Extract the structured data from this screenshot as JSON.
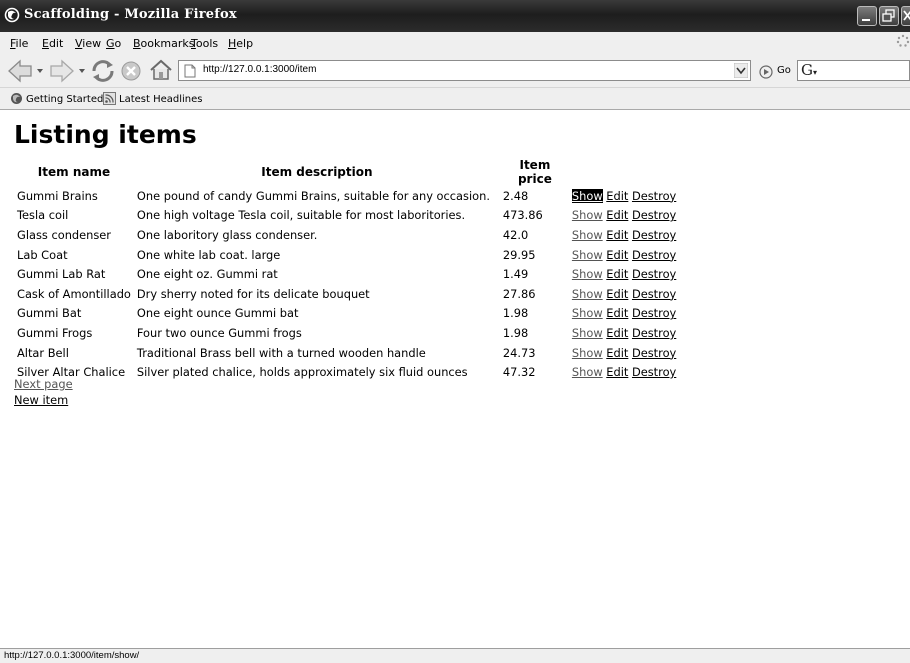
{
  "window": {
    "title": "Scaffolding - Mozilla Firefox"
  },
  "menu": [
    {
      "label": "File",
      "key": "F",
      "rest": "ile"
    },
    {
      "label": "Edit",
      "key": "E",
      "rest": "dit"
    },
    {
      "label": "View",
      "key": "V",
      "rest": "iew"
    },
    {
      "label": "Go",
      "key": "G",
      "rest": "o"
    },
    {
      "label": "Bookmarks",
      "key": "B",
      "rest": "ookmarks"
    },
    {
      "label": "Tools",
      "key": "T",
      "rest": "ools"
    },
    {
      "label": "Help",
      "key": "H",
      "rest": "elp"
    }
  ],
  "navbar": {
    "url": "http://127.0.0.1:3000/item",
    "go_label": "Go",
    "search_engine_icon": "google-g-icon"
  },
  "bookmarks": [
    {
      "label": "Getting Started",
      "icon": "firefox-icon"
    },
    {
      "label": "Latest Headlines",
      "icon": "rss-feed-icon"
    }
  ],
  "page": {
    "title": "Listing items",
    "columns": [
      "Item name",
      "Item description",
      "Item price"
    ],
    "rows": [
      {
        "name": "Gummi Brains",
        "description": "One pound of candy Gummi Brains, suitable for any occasion.",
        "price": "2.48"
      },
      {
        "name": "Tesla coil",
        "description": "One high voltage Tesla coil, suitable for most laboritories.",
        "price": "473.86"
      },
      {
        "name": "Glass condenser",
        "description": "One laboritory glass condenser.",
        "price": "42.0"
      },
      {
        "name": "Lab Coat",
        "description": "One white lab coat. large",
        "price": "29.95"
      },
      {
        "name": "Gummi Lab Rat",
        "description": "One eight oz. Gummi rat",
        "price": "1.49"
      },
      {
        "name": "Cask of Amontillado",
        "description": "Dry sherry noted for its delicate bouquet",
        "price": "27.86"
      },
      {
        "name": "Gummi Bat",
        "description": "One eight ounce Gummi bat",
        "price": "1.98"
      },
      {
        "name": "Gummi Frogs",
        "description": "Four two ounce Gummi frogs",
        "price": "1.98"
      },
      {
        "name": "Altar Bell",
        "description": "Traditional Brass bell with a turned wooden handle",
        "price": "24.73"
      },
      {
        "name": "Silver Altar Chalice",
        "description": "Silver plated chalice, holds approximately six fluid ounces",
        "price": "47.32"
      }
    ],
    "actions": {
      "show": "Show",
      "edit": "Edit",
      "destroy": "Destroy"
    },
    "next_page": "Next page",
    "new_item": "New item"
  },
  "status": {
    "text": "http://127.0.0.1:3000/item/show/"
  }
}
